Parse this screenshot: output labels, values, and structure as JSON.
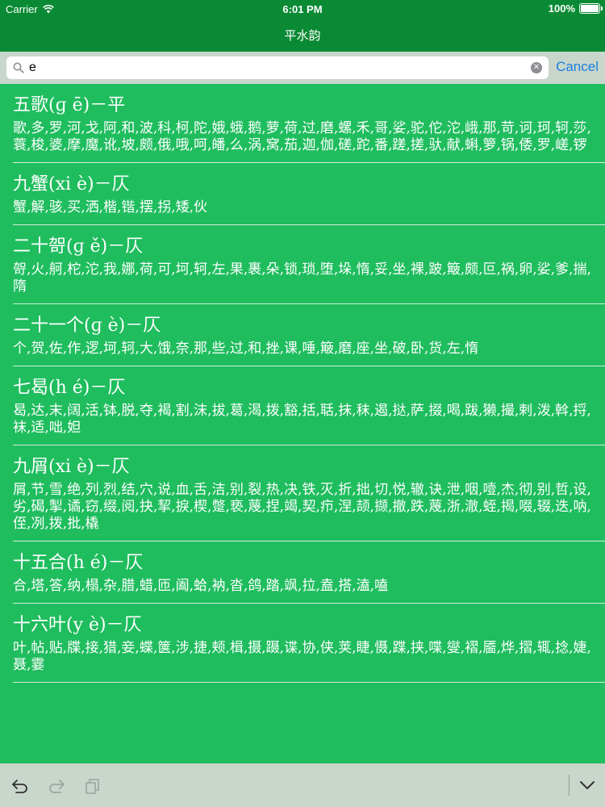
{
  "status_bar": {
    "carrier": "Carrier",
    "time": "6:01 PM",
    "battery": "100%"
  },
  "nav": {
    "title": "平水韵"
  },
  "search": {
    "value": "e",
    "cancel_label": "Cancel"
  },
  "entries": [
    {
      "title": "五歌(ɡ ē)－平",
      "chars": "歌,多,罗,河,戈,阿,和,波,科,柯,陀,娥,蛾,鹅,萝,荷,过,磨,螺,禾,哥,娑,驼,佗,沱,峨,那,苛,诃,珂,轲,莎,蓑,梭,婆,摩,魔,讹,坡,颇,俄,哦,呵,皤,么,涡,窝,茄,迦,伽,磋,跎,番,蹉,搓,驮,献,蝌,箩,锅,倭,罗,嵯,锣"
    },
    {
      "title": "九蟹(xi è)－仄",
      "chars": "蟹,解,骇,买,洒,楷,锴,摆,拐,矮,伙"
    },
    {
      "title": "二十哿(ɡ ě)－仄",
      "chars": "哿,火,舸,柁,沱,我,娜,荷,可,坷,轲,左,果,裹,朵,锁,琐,堕,垛,惰,妥,坐,裸,跛,簸,颇,叵,祸,卵,娑,爹,揣,隋"
    },
    {
      "title": "二十一个(ɡ è)－仄",
      "chars": "个,贺,佐,作,逻,坷,轲,大,饿,奈,那,些,过,和,挫,课,唾,簸,磨,座,坐,破,卧,货,左,惰"
    },
    {
      "title": "七曷(h é)－仄",
      "chars": "曷,达,末,阔,活,钵,脱,夺,褐,割,沫,拔,葛,渴,拨,豁,括,聒,抹,秣,遏,挞,萨,掇,喝,跋,獭,撮,剌,泼,斡,捋,袜,适,咄,妲"
    },
    {
      "title": "九屑(xi è)－仄",
      "chars": "屑,节,雪,绝,列,烈,结,穴,说,血,舌,洁,别,裂,热,决,铁,灭,折,拙,切,悦,辙,诀,泄,咽,噎,杰,彻,别,哲,设,劣,碣,掣,谲,窃,缀,阅,抉,挈,捩,楔,蹩,亵,蔑,捏,竭,契,疖,涅,颉,撷,撤,跌,蔑,浙,澈,蛭,揭,啜,辍,迭,呐,侄,冽,拨,批,橇"
    },
    {
      "title": "十五合(h é)－仄",
      "chars": "合,塔,答,纳,榻,杂,腊,蜡,匝,阖,蛤,衲,沓,鸽,踏,飒,拉,盍,搭,溘,嗑"
    },
    {
      "title": "十六叶(y è)－仄",
      "chars": "叶,帖,贴,牒,接,猎,妾,蝶,箧,涉,捷,颊,楫,摄,蹑,谍,协,侠,荚,睫,慑,蹀,挟,喋,燮,褶,靥,烨,摺,辄,捻,婕,聂,霎"
    }
  ]
}
